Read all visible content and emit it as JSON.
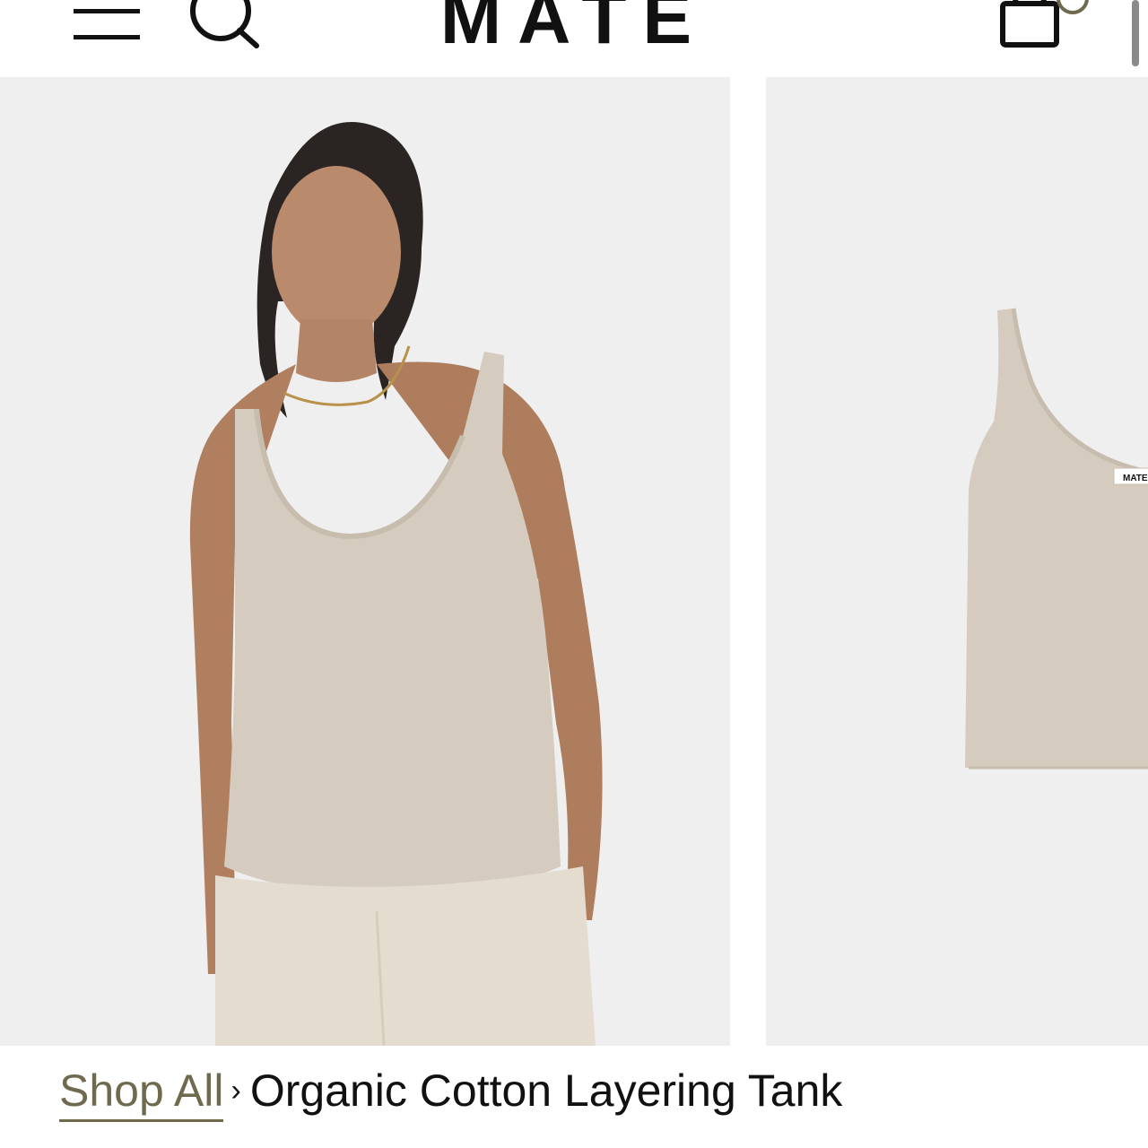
{
  "header": {
    "logo_text": "MATE",
    "icons": {
      "menu": "hamburger-menu-icon",
      "search": "search-icon",
      "cart": "shopping-bag-icon"
    }
  },
  "gallery": {
    "slides": [
      {
        "description_kind": "model-photo",
        "alt": "Organic Cotton Layering Tank"
      },
      {
        "description_kind": "flat-product-photo",
        "alt": "Organic Cotton Layering Tank",
        "tag_text": "MATE"
      }
    ],
    "background": "#efefef",
    "garment_color": "#d5ccbf"
  },
  "breadcrumb": {
    "parent_label": "Shop All",
    "separator": "›",
    "current_label": "Organic Cotton Layering Tank"
  },
  "colors": {
    "accent": "#6f6a4e",
    "text": "#111111"
  }
}
